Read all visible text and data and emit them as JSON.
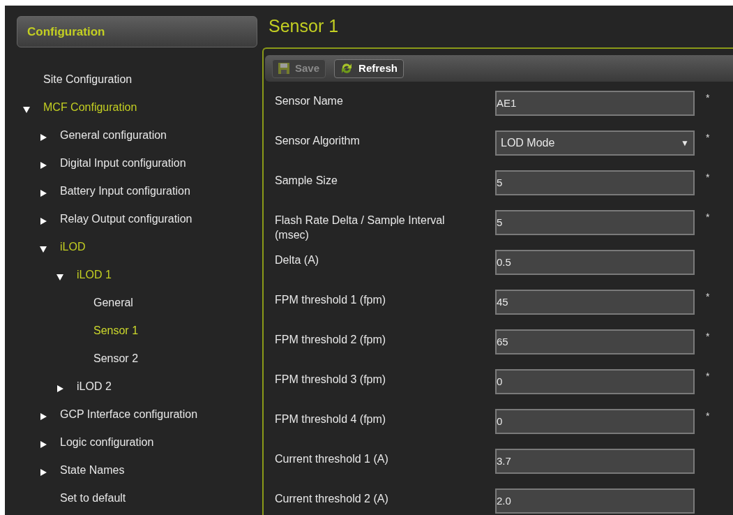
{
  "sidebar": {
    "title": "Configuration",
    "tree": [
      {
        "label": "Site Configuration",
        "selected": false
      },
      {
        "label": "MCF Configuration",
        "expanded": true,
        "children": [
          {
            "label": "General configuration",
            "expanded": false,
            "selected": false
          },
          {
            "label": "Digital Input configuration",
            "expanded": false,
            "selected": false
          },
          {
            "label": "Battery Input configuration",
            "expanded": false,
            "selected": false
          },
          {
            "label": "Relay Output configuration",
            "expanded": false,
            "selected": false
          },
          {
            "label": "iLOD",
            "expanded": true,
            "children": [
              {
                "label": "iLOD 1",
                "expanded": true,
                "children": [
                  {
                    "label": "General",
                    "selected": false
                  },
                  {
                    "label": "Sensor 1",
                    "selected": true
                  },
                  {
                    "label": "Sensor 2",
                    "selected": false
                  }
                ]
              },
              {
                "label": "iLOD 2",
                "expanded": false,
                "selected": false
              }
            ]
          },
          {
            "label": "GCP Interface configuration",
            "expanded": false,
            "selected": false
          },
          {
            "label": "Logic configuration",
            "expanded": false,
            "selected": false
          },
          {
            "label": "State Names",
            "expanded": false,
            "selected": false
          },
          {
            "label": "Set to default",
            "selected": false
          }
        ]
      }
    ]
  },
  "page": {
    "title": "Sensor 1",
    "toolbar": [
      {
        "label": "Save",
        "kind": "save",
        "disabled": true
      },
      {
        "label": "Refresh",
        "kind": "refresh",
        "disabled": false
      }
    ],
    "fields": [
      {
        "label": "Sensor Name",
        "kind": "text",
        "value": "AE1",
        "mark": "*"
      },
      {
        "label": "Sensor Algorithm",
        "kind": "select",
        "value": "LOD Mode",
        "caret": "▼",
        "mark": "*"
      },
      {
        "label": "Sample Size",
        "kind": "text",
        "value": "5",
        "mark": "*"
      },
      {
        "label": "Flash Rate Delta / Sample Interval (msec)",
        "kind": "text",
        "value": "5",
        "mark": "*"
      },
      {
        "label": "Delta (A)",
        "kind": "text",
        "value": "0.5"
      },
      {
        "label": "FPM threshold 1 (fpm)",
        "kind": "text",
        "value": "45",
        "mark": "*"
      },
      {
        "label": "FPM threshold 2 (fpm)",
        "kind": "text",
        "value": "65",
        "mark": "*"
      },
      {
        "label": "FPM threshold 3 (fpm)",
        "kind": "text",
        "value": "0",
        "mark": "*"
      },
      {
        "label": "FPM threshold 4 (fpm)",
        "kind": "text",
        "value": "0",
        "mark": "*"
      },
      {
        "label": "Current threshold 1 (A)",
        "kind": "text",
        "value": "3.7"
      },
      {
        "label": "Current threshold 2 (A)",
        "kind": "text",
        "value": "2.0"
      }
    ]
  }
}
